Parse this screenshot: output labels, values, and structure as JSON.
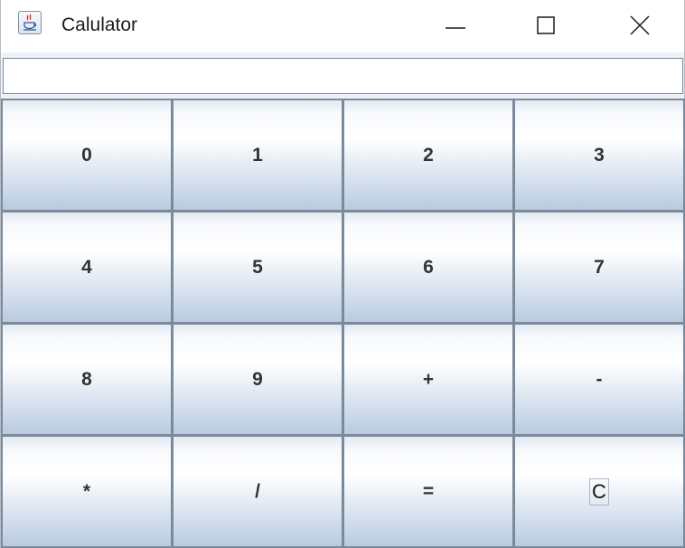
{
  "window": {
    "title": "Calulator",
    "icon": "java-coffee-cup-icon",
    "controls": {
      "minimize": "minimize-icon",
      "maximize": "maximize-icon",
      "close": "close-icon"
    }
  },
  "display": {
    "value": "",
    "placeholder": ""
  },
  "keys": [
    "0",
    "1",
    "2",
    "3",
    "4",
    "5",
    "6",
    "7",
    "8",
    "9",
    "+",
    "-",
    "*",
    "/",
    "=",
    "C"
  ],
  "colors": {
    "key_border": "#7b8a9b",
    "key_gradient_top": "#ffffff",
    "key_gradient_bottom": "#b8cbe0",
    "titlebar": "#ffffff"
  }
}
